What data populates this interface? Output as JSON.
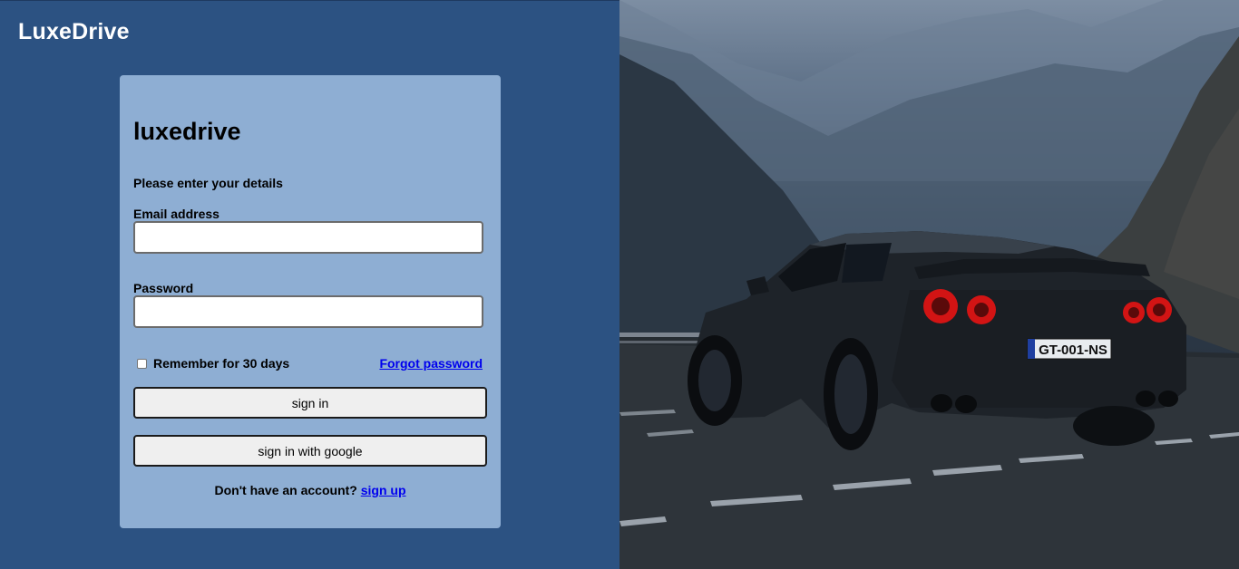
{
  "brand": {
    "name": "LuxeDrive"
  },
  "login": {
    "title": "luxedrive",
    "subtitle": "Please enter your details",
    "email_label": "Email address",
    "email_value": "",
    "password_label": "Password",
    "password_value": "",
    "remember_label": "Remember for 30 days",
    "remember_checked": false,
    "forgot_label": "Forgot password",
    "signin_label": "sign in",
    "google_label": "sign in with google",
    "no_account_text": "Don't have an account?",
    "signup_label": "sign up"
  },
  "hero": {
    "plate_text": "GT-001-NS"
  },
  "colors": {
    "left_background": "#2c5282",
    "card_background": "#8eaed3",
    "link": "#0000ee",
    "tail_light": "#d21414"
  }
}
